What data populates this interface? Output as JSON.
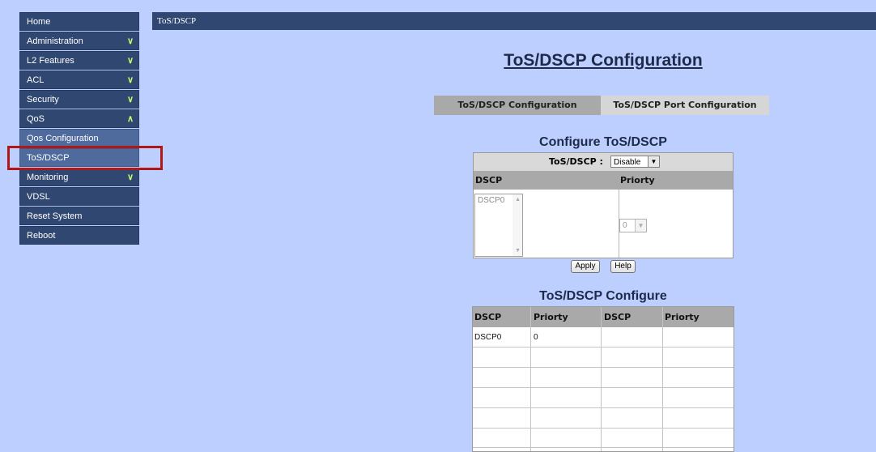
{
  "header": {
    "breadcrumb": "ToS/DSCP"
  },
  "sidebar": {
    "items": [
      {
        "label": "Home"
      },
      {
        "label": "Administration",
        "chevron": "chevron-down-icon"
      },
      {
        "label": "L2 Features",
        "chevron": "chevron-down-icon"
      },
      {
        "label": "ACL",
        "chevron": "chevron-down-icon"
      },
      {
        "label": "Security",
        "chevron": "chevron-down-icon"
      },
      {
        "label": "QoS",
        "chevron": "chevron-up-icon"
      },
      {
        "label": "Qos Configuration"
      },
      {
        "label": "ToS/DSCP",
        "selected": true
      },
      {
        "label": "Monitoring",
        "chevron": "chevron-down-icon"
      },
      {
        "label": "VDSL"
      },
      {
        "label": "Reset System"
      },
      {
        "label": "Reboot"
      }
    ]
  },
  "main": {
    "title": "ToS/DSCP Configuration",
    "tabs": [
      {
        "label": "ToS/DSCP Configuration",
        "active": true
      },
      {
        "label": "ToS/DSCP Port Configuration",
        "active": false
      }
    ],
    "configure": {
      "title": "Configure ToS/DSCP",
      "mode_label": "ToS/DSCP :",
      "mode_value": "Disable",
      "col_dscp": "DSCP",
      "col_priority": "Priorty",
      "dscp_list_item": "DSCP0",
      "priority_value": "0",
      "apply_label": "Apply",
      "help_label": "Help"
    },
    "table": {
      "title": "ToS/DSCP Configure",
      "headers": [
        "DSCP",
        "Priorty",
        "DSCP",
        "Priorty"
      ],
      "rows": [
        [
          "DSCP0",
          "0",
          "",
          ""
        ]
      ]
    }
  },
  "colors": {
    "page_bg": "#bccfff",
    "nav_bg": "#304771",
    "nav_sub_bg": "#4f6a9c",
    "highlight": "#b01717",
    "chevron": "#c9ff6a"
  }
}
